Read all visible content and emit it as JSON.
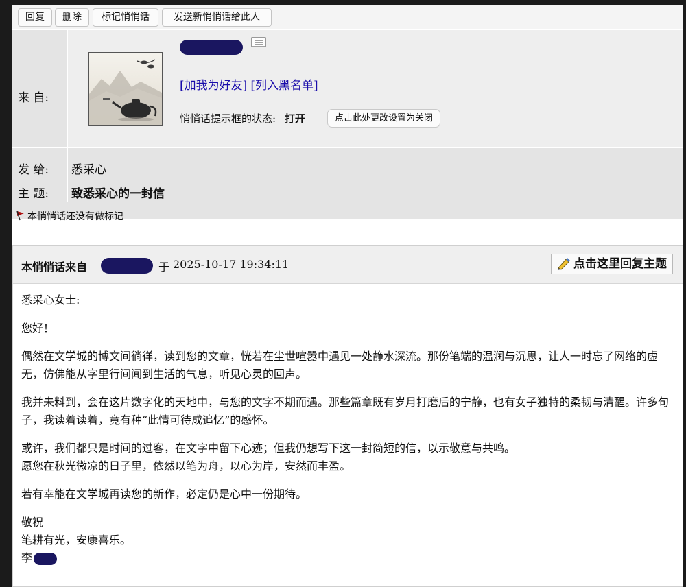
{
  "toolbar": {
    "reply": "回复",
    "delete": "删除",
    "mark": "标记悄悄话",
    "send_new": "发送新悄悄话给此人"
  },
  "header": {
    "from_label": "来 自:",
    "add_friend": "加我为好友",
    "blacklist": "列入黑名单",
    "tip_status_label": "悄悄话提示框的状态:",
    "tip_status_value": "打开",
    "change_setting": "点击此处更改设置为关闭",
    "to_label": "发 给:",
    "to_value": "悉采心",
    "subject_label": "主 题:",
    "subject_value": "致悉采心的一封信",
    "mark_status": "本悄悄话还没有做标记"
  },
  "message": {
    "from_prefix": "本悄悄话来自",
    "at": "于",
    "timestamp": "2025-10-17 19:34:11",
    "reply_button": "点击这里回复主题",
    "greeting": "悉采心女士:",
    "hello": "您好！",
    "p1": "偶然在文学城的博文间徜徉，读到您的文章，恍若在尘世喧嚣中遇见一处静水深流。那份笔端的温润与沉思，让人一时忘了网络的虚无，仿佛能从字里行间闻到生活的气息，听见心灵的回声。",
    "p2": "我并未料到，会在这片数字化的天地中，与您的文字不期而遇。那些篇章既有岁月打磨后的宁静，也有女子独特的柔韧与清醒。许多句子，我读着读着，竟有种“此情可待成追忆”的感怀。",
    "p3a": "或许，我们都只是时间的过客，在文字中留下心迹；但我仍想写下这一封简短的信，以示敬意与共鸣。",
    "p3b": "愿您在秋光微凉的日子里，依然以笔为舟，以心为岸，安然而丰盈。",
    "p4": "若有幸能在文学城再读您的新作，必定仍是心中一份期待。",
    "closing": "敬祝",
    "wish": "笔耕有光，安康喜乐。",
    "signature": "李"
  },
  "colors": {
    "link": "#1a0dab",
    "redaction": "#1a1660",
    "header_bg": "#e4e4e4"
  }
}
